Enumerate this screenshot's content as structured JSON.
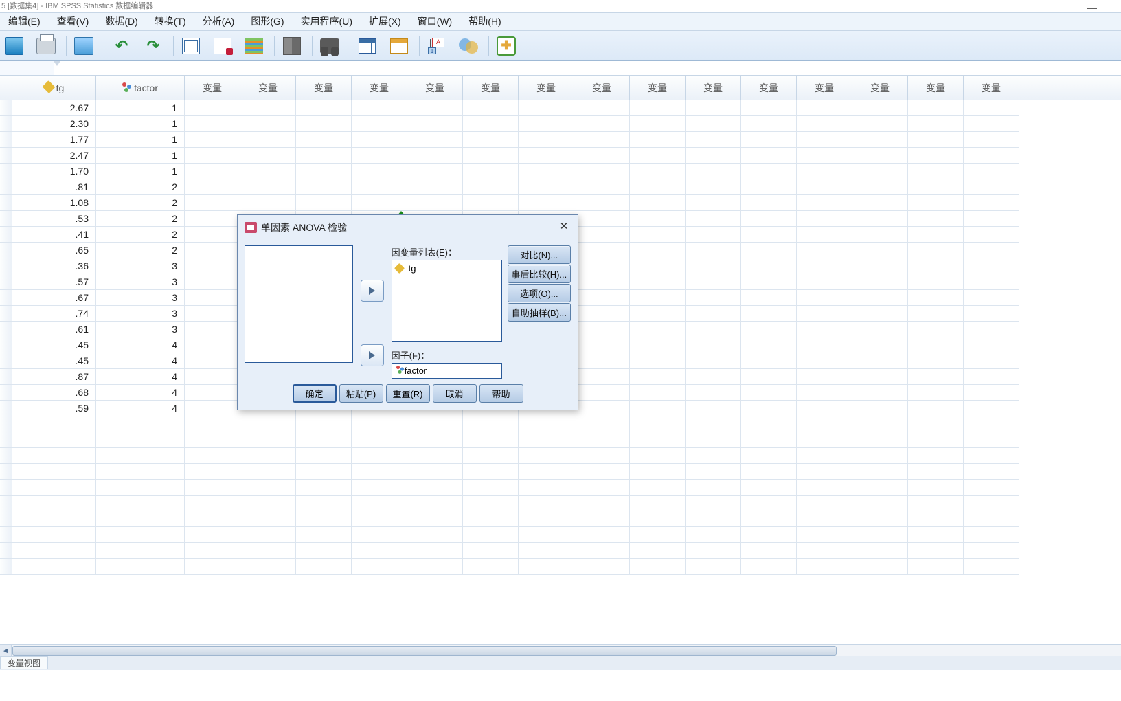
{
  "window": {
    "title": "5 [数据集4] - IBM SPSS Statistics 数据编辑器"
  },
  "menu": {
    "edit": "编辑(E)",
    "view": "查看(V)",
    "data": "数据(D)",
    "transform": "转换(T)",
    "analyze": "分析(A)",
    "graphs": "图形(G)",
    "utilities": "实用程序(U)",
    "extensions": "扩展(X)",
    "window": "窗口(W)",
    "help": "帮助(H)"
  },
  "columns": {
    "c1": "tg",
    "c2": "factor",
    "var": "变量"
  },
  "data_rows": [
    {
      "tg": "2.67",
      "factor": "1"
    },
    {
      "tg": "2.30",
      "factor": "1"
    },
    {
      "tg": "1.77",
      "factor": "1"
    },
    {
      "tg": "2.47",
      "factor": "1"
    },
    {
      "tg": "1.70",
      "factor": "1"
    },
    {
      "tg": ".81",
      "factor": "2"
    },
    {
      "tg": "1.08",
      "factor": "2"
    },
    {
      "tg": ".53",
      "factor": "2"
    },
    {
      "tg": ".41",
      "factor": "2"
    },
    {
      "tg": ".65",
      "factor": "2"
    },
    {
      "tg": ".36",
      "factor": "3"
    },
    {
      "tg": ".57",
      "factor": "3"
    },
    {
      "tg": ".67",
      "factor": "3"
    },
    {
      "tg": ".74",
      "factor": "3"
    },
    {
      "tg": ".61",
      "factor": "3"
    },
    {
      "tg": ".45",
      "factor": "4"
    },
    {
      "tg": ".45",
      "factor": "4"
    },
    {
      "tg": ".87",
      "factor": "4"
    },
    {
      "tg": ".68",
      "factor": "4"
    },
    {
      "tg": ".59",
      "factor": "4"
    }
  ],
  "dialog": {
    "title": "单因素 ANOVA 检验",
    "dep_label": "因变量列表(E)：",
    "dep_item": "tg",
    "factor_label": "因子(F)：",
    "factor_item": "factor",
    "btn_contrast": "对比(N)...",
    "btn_posthoc": "事后比较(H)...",
    "btn_options": "选项(O)...",
    "btn_bootstrap": "自助抽样(B)...",
    "ok": "确定",
    "paste": "粘贴(P)",
    "reset": "重置(R)",
    "cancel": "取消",
    "help": "帮助"
  },
  "tabs": {
    "t1": "变量视图"
  }
}
